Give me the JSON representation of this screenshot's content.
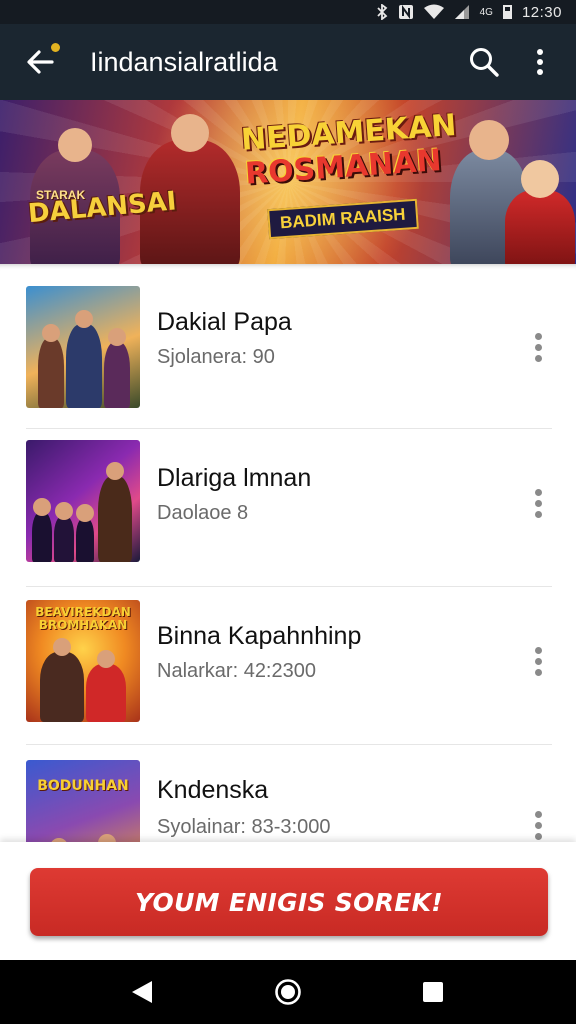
{
  "status_bar": {
    "time": "12:30",
    "icons": [
      "bluetooth-icon",
      "nfc-icon",
      "wifi-icon",
      "signal-icon",
      "battery-icon"
    ],
    "network_label": "4G"
  },
  "app_bar": {
    "title": "Iindansialratlida",
    "back_icon": "arrow-left-icon",
    "search_icon": "search-icon",
    "menu_icon": "more-vert-icon",
    "accent": "#e3b321"
  },
  "banner": {
    "left_logo_top": "STARAK",
    "left_logo": "DALANSAI",
    "title_line1": "NEDAMEKAN",
    "title_line2": "ROSMANAN",
    "subtitle": "BADIM RAAISH"
  },
  "list": {
    "items": [
      {
        "title": "Dakial Papa",
        "subtitle": "Sjolanera: 90",
        "thumb_text": ""
      },
      {
        "title": "Dlariga lmnan",
        "subtitle": "Daolaoe 8",
        "thumb_text": ""
      },
      {
        "title": "Binna Kapahnhinp",
        "subtitle": "Nalarkar: 42:2300",
        "thumb_text": "BEAVIREKDAN BROMHAKAN"
      },
      {
        "title": "Kndenska",
        "subtitle": "Syolainar: 83-3:000",
        "thumb_text": "BODUNHAN"
      }
    ]
  },
  "cta": {
    "label": "YOUM ENIGIS SOREK!",
    "color": "#d4302a"
  },
  "nav": {
    "back_icon": "triangle-back-icon",
    "home_icon": "circle-home-icon",
    "recents_icon": "square-recents-icon"
  }
}
